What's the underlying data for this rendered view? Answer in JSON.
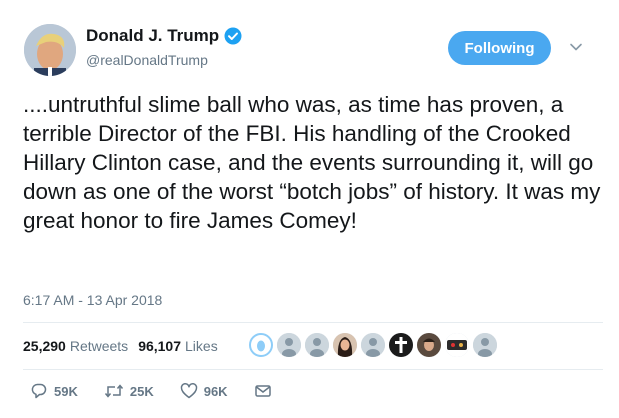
{
  "author": {
    "display_name": "Donald J. Trump",
    "handle": "@realDonaldTrump",
    "verified": true
  },
  "follow_button": {
    "label": "Following"
  },
  "tweet": {
    "text": "....untruthful slime ball who was, as time has proven, a terrible Director of the FBI. His handling of the Crooked Hillary Clinton case, and the events surrounding it, will go down as one of the worst “botch jobs” of history. It was my great honor to fire James Comey!",
    "timestamp": "6:17 AM - 13 Apr 2018"
  },
  "stats": {
    "retweets_count": "25,290",
    "retweets_label": "Retweets",
    "likes_count": "96,107",
    "likes_label": "Likes"
  },
  "actions": {
    "replies": "59K",
    "retweets": "25K",
    "likes": "96K"
  },
  "colors": {
    "accent": "#4aa8f0",
    "muted": "#657786",
    "text": "#14171a"
  },
  "icons": [
    "verified-badge-icon",
    "chevron-down-icon",
    "reply-icon",
    "retweet-icon",
    "heart-icon",
    "message-icon"
  ]
}
